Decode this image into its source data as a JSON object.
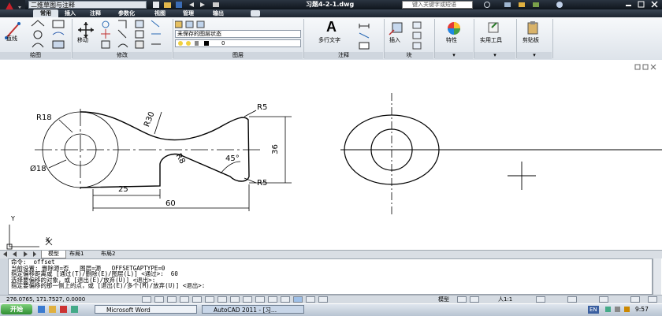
{
  "title_bar": {
    "workspace": "二维草图与注释",
    "document_title": "习题4-2-1.dwg",
    "search_placeholder": "键入关键字或短语"
  },
  "ribbon_tabs": [
    "常用",
    "插入",
    "注释",
    "参数化",
    "视图",
    "管理",
    "输出"
  ],
  "panels": {
    "draw": {
      "label": "绘图",
      "line_label": "直线"
    },
    "modify": {
      "label": "修改",
      "move_label": "移动"
    },
    "layers": {
      "label": "图层",
      "layer_state": "未保存的图层状态",
      "current_layer": "0"
    },
    "annotation": {
      "label": "注释",
      "mtext_label": "多行文字"
    },
    "block": {
      "label": "块",
      "insert_label": "插入"
    },
    "properties": {
      "label": "特性"
    },
    "utilities": {
      "label": "实用工具"
    },
    "clipboard": {
      "label": "剪贴板"
    }
  },
  "drawing_dims": {
    "r18": "R18",
    "r30": "R30",
    "r5_top": "R5",
    "r5_bottom": "R5",
    "r8": "R8",
    "angle": "45°",
    "dia18": "Ø18",
    "dim36": "36",
    "dim25": "25",
    "dim60": "60",
    "ucs_y": "Y",
    "ucs_x": "X"
  },
  "layout_tabs": [
    "模型",
    "布局1",
    "布局2"
  ],
  "command_lines": [
    "命令:  offset",
    "当前设置: 删除源=否   图层=源   OFFSETGAPTYPE=0",
    "指定偏移距离或 [通过(T)/删除(E)/图层(L)] <通过>:  60",
    "选择要偏移的对象，或 [退出(E)/放弃(U)] <退出>:",
    "指定要偏移的那一侧上的点，或 [退出(E)/多个(M)/放弃(U)] <退出>:"
  ],
  "status_bar": {
    "coordinates": "276.0765, 171.7527, 0.0000",
    "model": "模型",
    "scale": "人1:1"
  },
  "taskbar": {
    "start": "开始",
    "word": "Microsoft Word",
    "autocad": "AutoCAD 2011 - [习...",
    "lang": "EN",
    "time": "9:57"
  }
}
